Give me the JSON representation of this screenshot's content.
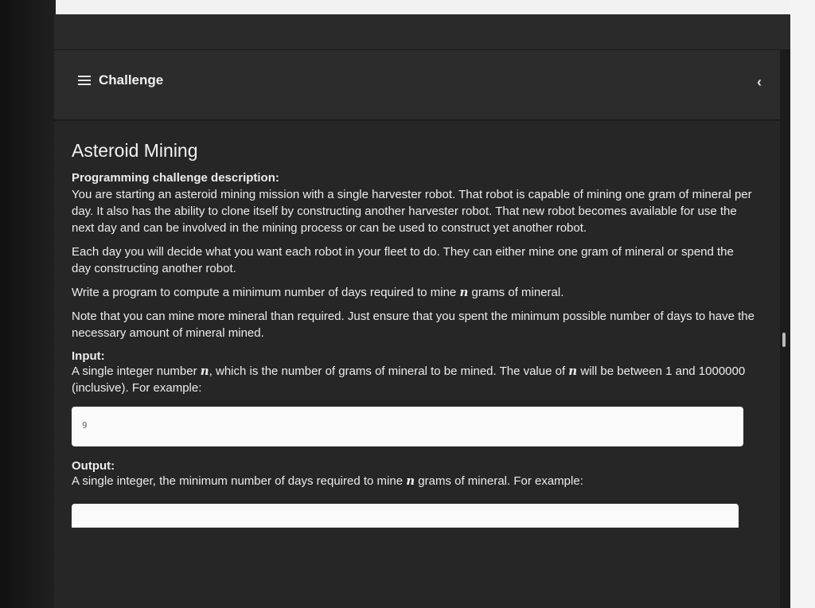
{
  "header": {
    "title": "Challenge",
    "menu_icon": "menu-icon",
    "collapse_icon": "chevron-left-icon"
  },
  "challenge": {
    "title": "Asteroid Mining",
    "description_heading": "Programming challenge description:",
    "para1": "You are starting an asteroid mining mission with a single harvester robot. That robot is capable of mining one gram of mineral per day. It also has the ability to clone itself by constructing another harvester robot. That new robot becomes available for use the next day and can be involved in the mining process or can be used to construct yet another robot.",
    "para2": "Each day you will decide what you want each robot in your fleet to do. They can either mine one gram of mineral or spend the day constructing another robot.",
    "para3_before": "Write a program to compute a minimum number of days required to mine ",
    "var_n": "n",
    "para3_after": " grams of mineral.",
    "para4": "Note that you can mine more mineral than required. Just ensure that you spent the minimum possible number of days to have the necessary amount of mineral mined.",
    "input_heading": "Input:",
    "input_text_1": "A single integer number ",
    "input_text_2": ", which is the number of grams of mineral to be mined. The value of ",
    "input_text_3": " will be between 1 and 1000000 (inclusive). For example:",
    "input_example": "9",
    "output_heading": "Output:",
    "output_text_1": "A single integer, the minimum number of days required to mine ",
    "output_text_2": " grams of mineral. For example:"
  }
}
